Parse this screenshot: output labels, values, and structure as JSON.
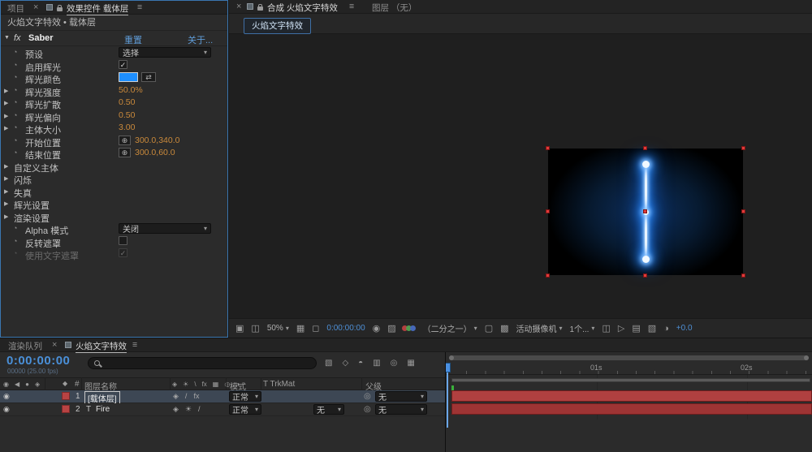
{
  "icons": {
    "close": "×",
    "panel_menu": "≡",
    "twirl_open": "▼",
    "twirl_closed": "▶",
    "dropdown_arrow": "▾",
    "stopwatch": "◔",
    "crosshair": "⊕",
    "eyedropper": "⇄",
    "eye": "◉",
    "audio": "◀",
    "solo": "●",
    "lock": "◈",
    "label_flag": "◆",
    "pick_whip": "◎",
    "quality": "◈",
    "collapse": "☀",
    "slash": "/",
    "backslash": "\\",
    "fx": "fx",
    "frame_blend": "▦",
    "motion_blur": "◎",
    "adjustment": "◑",
    "monitor": "▣",
    "window": "◫",
    "grid_options": "▦",
    "mask_vis": "◻",
    "snapshot": "◉",
    "show_snapshot": "▨",
    "roi": "▢",
    "transparency_grid": "▩",
    "pixel_aspect": "◫",
    "fast_preview": "▷",
    "timeline_btn": "▤",
    "flowchart": "▧",
    "exposure": "◑",
    "mini_flowchart": "▧",
    "draft_3d": "◇",
    "shy": "◓",
    "frame_blend_btn": "▥",
    "motion_blur_btn": "◎",
    "graph_editor": "▦"
  },
  "colors": {
    "accent_blue": "#4a90d9",
    "value_orange": "#c9893b",
    "layer_red": "#a83636",
    "glow_blue": "#2f8fff"
  },
  "effect_panel": {
    "tabs": {
      "project": "项目",
      "effect_controls": "效果控件",
      "effect_layer": "载体层"
    },
    "breadcrumb": "火焰文字特效 • 载体层",
    "effect": {
      "fx_badge": "fx",
      "name": "Saber",
      "reset": "重置",
      "about": "关于..."
    },
    "rows": [
      {
        "label": "预设",
        "value": "选择"
      },
      {
        "label": "启用辉光",
        "check": "✓"
      },
      {
        "label": "辉光颜色",
        "swatch_style": "background:#1e8fff"
      },
      {
        "label": "辉光强度",
        "value": "50.0%"
      },
      {
        "label": "辉光扩散",
        "value": "0.50"
      },
      {
        "label": "辉光偏向",
        "value": "0.50"
      },
      {
        "label": "主体大小",
        "value": "3.00"
      },
      {
        "label": "开始位置",
        "value": "300.0,340.0"
      },
      {
        "label": "结束位置",
        "value": "300.0,60.0"
      },
      {
        "label": "自定义主体"
      },
      {
        "label": "闪烁"
      },
      {
        "label": "失真"
      },
      {
        "label": "辉光设置"
      },
      {
        "label": "渲染设置"
      },
      {
        "label": "Alpha 模式",
        "value": "关闭"
      },
      {
        "label": "反转遮罩",
        "check": ""
      },
      {
        "label": "使用文字遮罩",
        "check": "✓"
      }
    ]
  },
  "comp_panel": {
    "tabs": {
      "comp_prefix": "合成",
      "comp_name": "火焰文字特效",
      "layer_prefix": "图层",
      "layer_name": "（无）"
    },
    "comp_button": "火焰文字特效",
    "toolbar": {
      "zoom": "50%",
      "timecode": "0:00:00:00",
      "resolution": "（二分之一）",
      "camera": "活动摄像机",
      "views": "1个...",
      "exposure": "+0.0"
    }
  },
  "timeline": {
    "tabs": {
      "render_queue": "渲染队列",
      "comp": "火焰文字特效"
    },
    "timecode": "0:00:00:00",
    "frame_info": "00000 (25.00 fps)",
    "columns": {
      "hash": "#",
      "layer_name": "图层名称",
      "mode": "模式",
      "trkmat": "T TrkMat",
      "parent": "父级"
    },
    "layers": [
      {
        "index": "1",
        "name": "[载体层]",
        "mode": "正常",
        "parent": "无"
      },
      {
        "index": "2",
        "type_glyph": "T",
        "name": "Fire",
        "mode": "正常",
        "trkmat": "无",
        "parent": "无"
      }
    ],
    "ruler_labels": [
      "01s",
      "02s"
    ]
  }
}
